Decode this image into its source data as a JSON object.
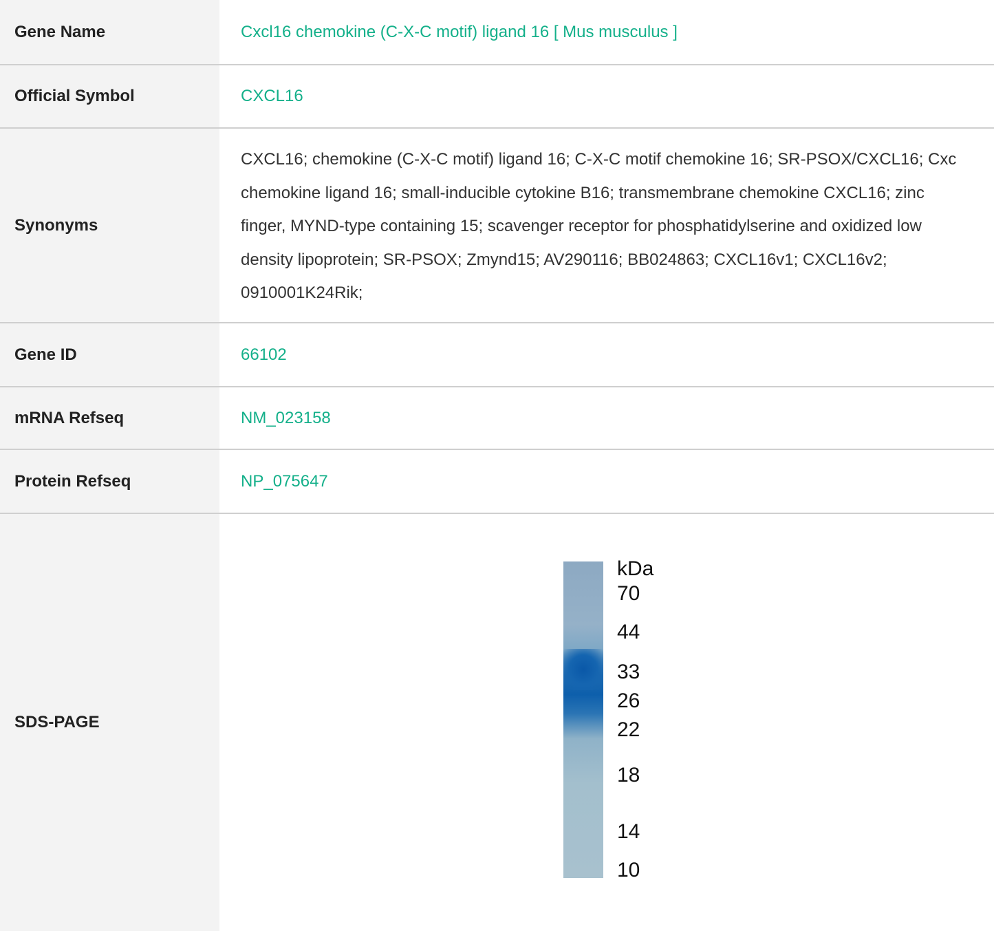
{
  "rows": {
    "gene_name": {
      "label": "Gene Name",
      "value": "Cxcl16 chemokine (C-X-C motif) ligand 16 [ Mus musculus ]"
    },
    "official_symbol": {
      "label": "Official Symbol",
      "value": "CXCL16"
    },
    "synonyms": {
      "label": "Synonyms",
      "value": "CXCL16; chemokine (C-X-C motif) ligand 16; C-X-C motif chemokine 16; SR-PSOX/CXCL16; Cxc chemokine ligand 16; small-inducible cytokine B16; transmembrane chemokine CXCL16; zinc finger, MYND-type containing 15; scavenger receptor for phosphatidylserine and oxidized low density lipoprotein; SR-PSOX; Zmynd15; AV290116; BB024863; CXCL16v1; CXCL16v2; 0910001K24Rik;"
    },
    "gene_id": {
      "label": "Gene ID",
      "value": "66102"
    },
    "mrna_refseq": {
      "label": "mRNA Refseq",
      "value": "NM_023158"
    },
    "protein_refseq": {
      "label": "Protein Refseq",
      "value": "NP_075647"
    },
    "sds_page": {
      "label": "SDS-PAGE",
      "unit": "kDa",
      "markers": [
        "70",
        "44",
        "33",
        "26",
        "22",
        "18",
        "14",
        "10"
      ]
    }
  },
  "colors": {
    "link": "#14b08a",
    "label_bg": "#f3f3f3",
    "divider": "#cfcfcf",
    "band": "#0d5fac"
  }
}
